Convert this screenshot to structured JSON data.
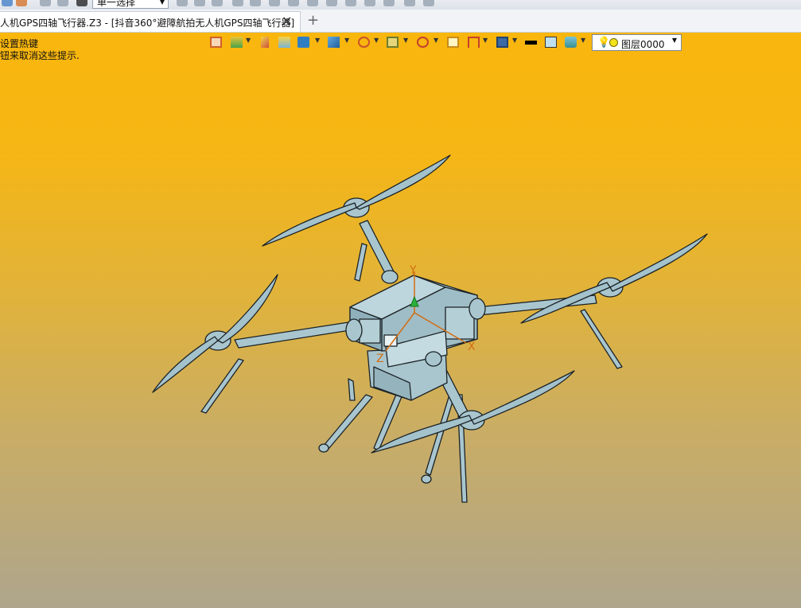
{
  "toolbar": {
    "select_mode": "单一选择"
  },
  "tabs": [
    {
      "label": "人机GPS四轴飞行器.Z3 - [抖音360°避障航拍无人机GPS四轴飞行器]",
      "close": "✕"
    }
  ],
  "tab_add": "+",
  "hints": {
    "line1": "设置热键",
    "line2": "钮来取消这些提示."
  },
  "layer": {
    "value": "图层0000",
    "bulb_icon": "💡",
    "arrow": "▼"
  },
  "axes": {
    "x": "X",
    "y": "Y",
    "z": "Z"
  },
  "colors": {
    "viewport_top": "#f9b60d",
    "viewport_bottom": "#aea58c",
    "model": "#a9c6cf"
  }
}
